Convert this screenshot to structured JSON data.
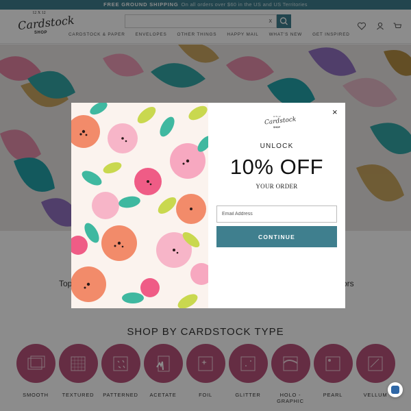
{
  "announcement": {
    "bold": "FREE GROUND SHIPPING",
    "rest": "On all orders over $60 in the US and US Territories"
  },
  "logo": {
    "top": "12 X 12",
    "script": "Cardstock",
    "shop": "SHOP"
  },
  "search": {
    "clear": "x",
    "placeholder": ""
  },
  "nav": [
    "CARDSTOCK & PAPER",
    "ENVELOPES",
    "OTHER THINGS",
    "HAPPY MAIL",
    "WHAT'S NEW",
    "GET INSPIRED"
  ],
  "header_icons": [
    "heart-icon",
    "user-icon",
    "cart-icon"
  ],
  "tagline": {
    "left": "Top",
    "right": "ors"
  },
  "section_title": "SHOP BY CARDSTOCK TYPE",
  "cardstock_types": [
    "SMOOTH",
    "TEXTURED",
    "PATTERNED",
    "ACETATE",
    "FOIL",
    "GLITTER",
    "HOLO - GRAPHIC",
    "PEARL",
    "VELLUM"
  ],
  "popup": {
    "close": "×",
    "unlock": "UNLOCK",
    "offer": "10% OFF",
    "sub": "YOUR ORDER",
    "email_placeholder": "Email Address",
    "button": "CONTINUE"
  },
  "colors": {
    "accent": "#3f7f8e",
    "type_circle": "#b8537a"
  }
}
